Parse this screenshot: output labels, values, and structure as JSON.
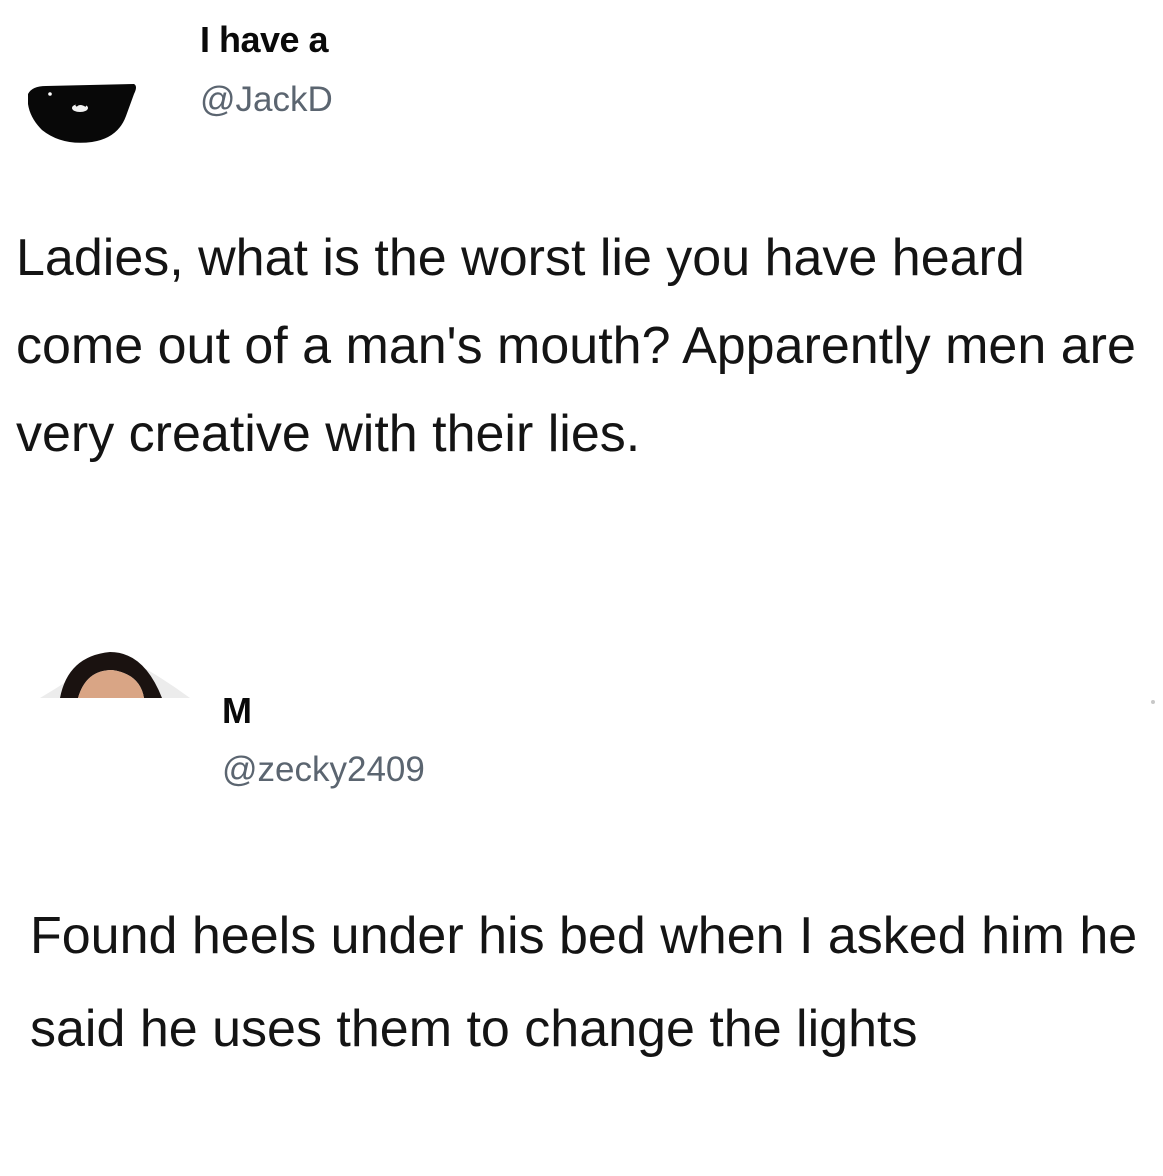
{
  "tweets": [
    {
      "display_name": "I have a",
      "handle": "@JackD",
      "text": "Ladies, what is the worst lie you have heard come out of a man's mouth? Apparently men are very creative with their lies."
    },
    {
      "display_name": "M",
      "handle": "@zecky2409",
      "text": "Found heels under his bed when I asked him he said he uses them to change the lights"
    }
  ],
  "icons": {
    "avatar_1": "profile-avatar-icon",
    "avatar_2": "profile-avatar-icon"
  }
}
